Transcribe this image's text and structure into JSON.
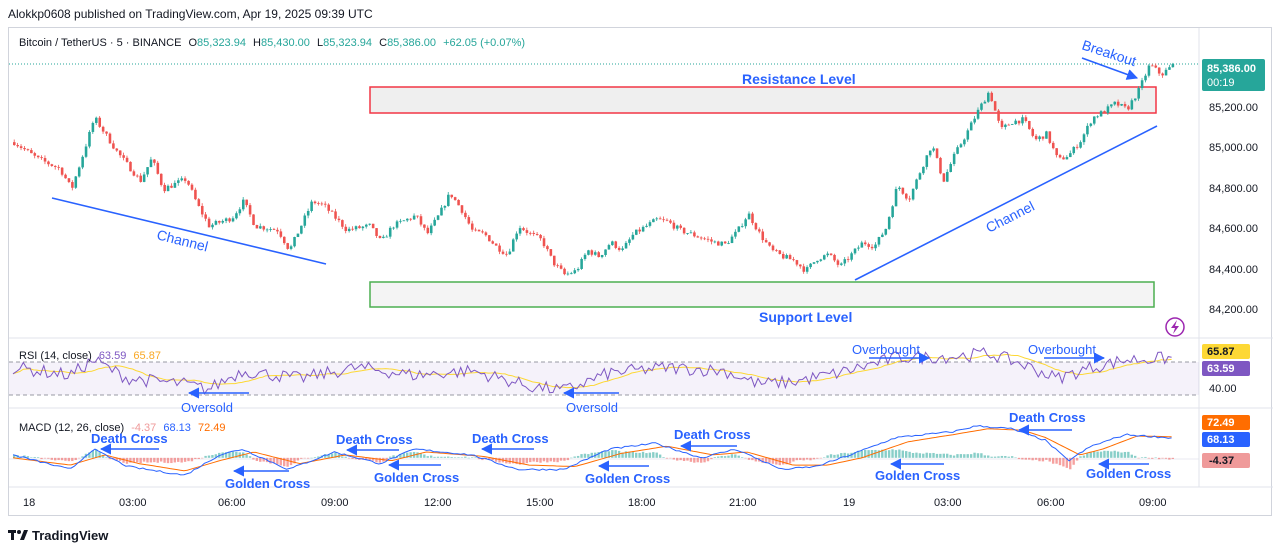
{
  "header": {
    "published": "Alokkp0608 published on TradingView.com, Apr 19, 2025 09:39 UTC"
  },
  "legend": {
    "symbol": "Bitcoin / TetherUS · 5 · BINANCE",
    "o_label": "O",
    "o_value": "85,323.94",
    "h_label": "H",
    "h_value": "85,430.00",
    "l_label": "L",
    "l_value": "85,323.94",
    "c_label": "C",
    "c_value": "85,386.00",
    "change": "+62.05 (+0.07%)"
  },
  "rsi_legend": {
    "name": "RSI (14, close)",
    "v1": "63.59",
    "v2": "65.87"
  },
  "macd_legend": {
    "name": "MACD (12, 26, close)",
    "v1": "-4.37",
    "v2": "68.13",
    "v3": "72.49"
  },
  "price_axis": {
    "ticks": [
      "85,200.00",
      "85,000.00",
      "84,800.00",
      "84,600.00",
      "84,400.00",
      "84,200.00"
    ],
    "last_price": "85,386.00",
    "countdown": "00:19"
  },
  "rsi_axis": {
    "tag1": "65.87",
    "tag2": "63.59",
    "tick": "40.00"
  },
  "macd_axis": {
    "tag1": "72.49",
    "tag2": "68.13",
    "tag3": "-4.37"
  },
  "time_axis": [
    "18",
    "03:00",
    "06:00",
    "09:00",
    "12:00",
    "15:00",
    "18:00",
    "21:00",
    "19",
    "03:00",
    "06:00",
    "09:00"
  ],
  "annotations": {
    "resistance": "Resistance Level",
    "support": "Support Level",
    "breakout": "Breakout",
    "channel_left": "Channel",
    "channel_right": "Channel",
    "overbought_1": "Overbought",
    "overbought_2": "Overbought",
    "oversold_1": "Oversold",
    "oversold_2": "Oversold",
    "death_cross_1": "Death Cross",
    "death_cross_2": "Death Cross",
    "death_cross_3": "Death Cross",
    "death_cross_4": "Death Cross",
    "death_cross_5": "Death Cross",
    "golden_cross_1": "Golden Cross",
    "golden_cross_2": "Golden Cross",
    "golden_cross_3": "Golden Cross",
    "golden_cross_4": "Golden Cross",
    "golden_cross_5": "Golden Cross"
  },
  "footer": {
    "brand": "TradingView"
  },
  "colors": {
    "bull": "#26a69a",
    "bear": "#ef5350",
    "annotation_blue": "#2962ff",
    "resistance_border": "#f23645",
    "support_border": "#4caf50",
    "rsi_line": "#7e57c2",
    "rsi_ma": "#fdd835",
    "macd_line": "#2962ff",
    "signal_line": "#ff6d00"
  },
  "chart_data": {
    "type": "candlestick",
    "symbol": "BTCUSDT",
    "interval": "5m",
    "ylim": [
      84100,
      85520
    ],
    "price_path": [
      [
        0,
        85010
      ],
      [
        2,
        84930
      ],
      [
        4,
        84880
      ],
      [
        5,
        84780
      ],
      [
        6,
        84950
      ],
      [
        7,
        85130
      ],
      [
        9,
        84960
      ],
      [
        11,
        84820
      ],
      [
        12,
        84930
      ],
      [
        13,
        84780
      ],
      [
        15,
        84830
      ],
      [
        16,
        84700
      ],
      [
        17,
        84600
      ],
      [
        19,
        84640
      ],
      [
        20,
        84720
      ],
      [
        21,
        84600
      ],
      [
        23,
        84580
      ],
      [
        24,
        84480
      ],
      [
        25,
        84600
      ],
      [
        26,
        84720
      ],
      [
        27,
        84700
      ],
      [
        28,
        84640
      ],
      [
        29,
        84580
      ],
      [
        31,
        84600
      ],
      [
        32,
        84520
      ],
      [
        33,
        84600
      ],
      [
        35,
        84650
      ],
      [
        36,
        84560
      ],
      [
        37,
        84650
      ],
      [
        38,
        84760
      ],
      [
        39,
        84680
      ],
      [
        40,
        84570
      ],
      [
        41,
        84560
      ],
      [
        42,
        84500
      ],
      [
        43,
        84460
      ],
      [
        44,
        84600
      ],
      [
        45,
        84560
      ],
      [
        46,
        84530
      ],
      [
        47,
        84420
      ],
      [
        48,
        84360
      ],
      [
        49,
        84380
      ],
      [
        50,
        84480
      ],
      [
        51,
        84450
      ],
      [
        52,
        84520
      ],
      [
        53,
        84480
      ],
      [
        54,
        84560
      ],
      [
        56,
        84630
      ],
      [
        57,
        84620
      ],
      [
        58,
        84580
      ],
      [
        59,
        84560
      ],
      [
        61,
        84520
      ],
      [
        62,
        84510
      ],
      [
        63,
        84570
      ],
      [
        64,
        84660
      ],
      [
        65,
        84560
      ],
      [
        66,
        84480
      ],
      [
        67,
        84450
      ],
      [
        68,
        84430
      ],
      [
        69,
        84380
      ],
      [
        70,
        84440
      ],
      [
        71,
        84460
      ],
      [
        72,
        84400
      ],
      [
        73,
        84460
      ],
      [
        74,
        84520
      ],
      [
        75,
        84500
      ],
      [
        76,
        84590
      ],
      [
        77,
        84800
      ],
      [
        78,
        84730
      ],
      [
        79,
        84870
      ],
      [
        80,
        85000
      ],
      [
        81,
        84820
      ],
      [
        82,
        84950
      ],
      [
        83,
        85050
      ],
      [
        84,
        85160
      ],
      [
        85,
        85260
      ],
      [
        86,
        85070
      ],
      [
        87,
        85110
      ],
      [
        88,
        85120
      ],
      [
        89,
        85020
      ],
      [
        90,
        85050
      ],
      [
        91,
        84920
      ],
      [
        92,
        84950
      ],
      [
        93,
        85020
      ],
      [
        94,
        85130
      ],
      [
        95,
        85160
      ],
      [
        96,
        85200
      ],
      [
        97,
        85170
      ],
      [
        98,
        85260
      ],
      [
        99,
        85390
      ],
      [
        100,
        85340
      ],
      [
        101,
        85386
      ]
    ],
    "rsi_range": [
      20,
      80
    ],
    "rsi_levels": [
      70,
      30
    ],
    "rsi_path": [
      [
        0,
        55
      ],
      [
        5,
        48
      ],
      [
        7,
        62
      ],
      [
        10,
        45
      ],
      [
        15,
        40
      ],
      [
        17,
        35
      ],
      [
        20,
        52
      ],
      [
        25,
        45
      ],
      [
        30,
        55
      ],
      [
        35,
        48
      ],
      [
        40,
        52
      ],
      [
        45,
        38
      ],
      [
        48,
        34
      ],
      [
        52,
        50
      ],
      [
        57,
        55
      ],
      [
        62,
        52
      ],
      [
        65,
        40
      ],
      [
        68,
        42
      ],
      [
        72,
        50
      ],
      [
        77,
        64
      ],
      [
        82,
        65
      ],
      [
        85,
        68
      ],
      [
        88,
        58
      ],
      [
        91,
        45
      ],
      [
        94,
        55
      ],
      [
        97,
        62
      ],
      [
        101,
        63.59
      ]
    ],
    "macd_range": [
      -90,
      130
    ],
    "macd_path": [
      [
        0,
        10
      ],
      [
        5,
        -40
      ],
      [
        7,
        30
      ],
      [
        10,
        -30
      ],
      [
        15,
        -60
      ],
      [
        18,
        10
      ],
      [
        20,
        30
      ],
      [
        24,
        -40
      ],
      [
        28,
        20
      ],
      [
        32,
        -20
      ],
      [
        35,
        30
      ],
      [
        40,
        10
      ],
      [
        44,
        -40
      ],
      [
        48,
        -40
      ],
      [
        52,
        30
      ],
      [
        56,
        50
      ],
      [
        60,
        0
      ],
      [
        63,
        30
      ],
      [
        67,
        -40
      ],
      [
        70,
        -30
      ],
      [
        73,
        10
      ],
      [
        77,
        70
      ],
      [
        82,
        90
      ],
      [
        84,
        110
      ],
      [
        87,
        100
      ],
      [
        90,
        60
      ],
      [
        92,
        -10
      ],
      [
        94,
        40
      ],
      [
        97,
        80
      ],
      [
        101,
        68.13
      ]
    ],
    "signal_path": [
      [
        0,
        0
      ],
      [
        5,
        -25
      ],
      [
        8,
        10
      ],
      [
        11,
        -20
      ],
      [
        15,
        -45
      ],
      [
        18,
        -10
      ],
      [
        21,
        20
      ],
      [
        25,
        -20
      ],
      [
        29,
        10
      ],
      [
        33,
        -10
      ],
      [
        36,
        20
      ],
      [
        41,
        5
      ],
      [
        45,
        -25
      ],
      [
        49,
        -30
      ],
      [
        53,
        15
      ],
      [
        57,
        40
      ],
      [
        61,
        10
      ],
      [
        64,
        20
      ],
      [
        68,
        -25
      ],
      [
        71,
        -25
      ],
      [
        74,
        0
      ],
      [
        78,
        55
      ],
      [
        82,
        80
      ],
      [
        85,
        100
      ],
      [
        88,
        95
      ],
      [
        90,
        70
      ],
      [
        93,
        10
      ],
      [
        95,
        30
      ],
      [
        98,
        75
      ],
      [
        101,
        72.49
      ]
    ]
  }
}
